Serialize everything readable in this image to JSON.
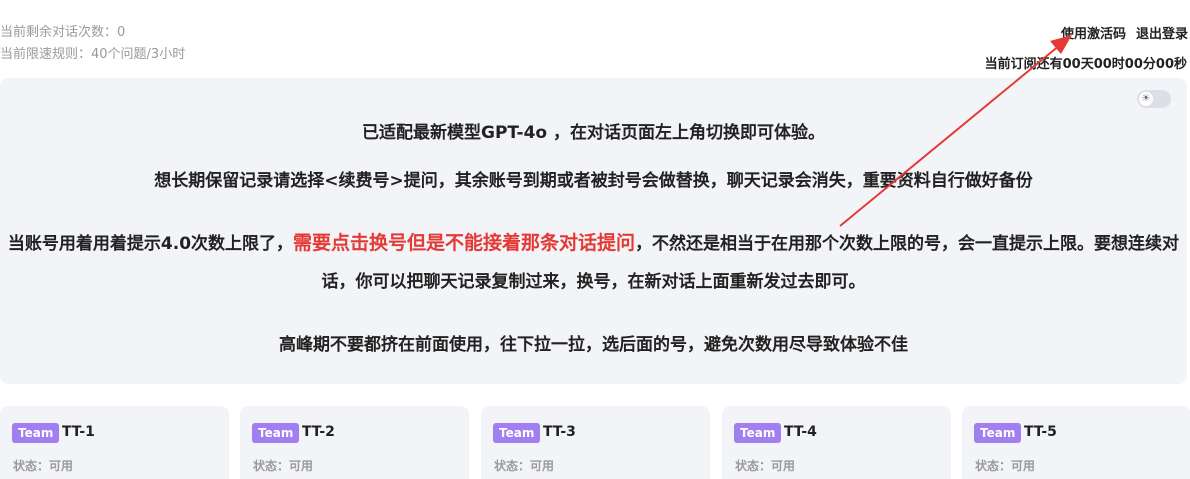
{
  "header": {
    "remaining_label": "当前剩余对话次数：0",
    "rate_limit_label": "当前限速规则：40个问题/3小时",
    "use_code_button": "使用激活码",
    "logout_button": "退出登录",
    "subscription_text": "当前订阅还有00天00时00分00秒"
  },
  "notice": {
    "line1": "已适配最新模型GPT-4o ，在对话页面左上角切换即可体验。",
    "line2": "想长期保留记录请选择<续费号>提问，其余账号到期或者被封号会做替换，聊天记录会消失，重要资料自行做好备份",
    "line3_prefix": "当账号用着用着提示4.0次数上限了，",
    "line3_highlight": "需要点击换号但是不能接着那条对话提问",
    "line3_suffix": "，不然还是相当于在用那个次数上限的号，会一直提示上限。要想连续对话，你可以把聊天记录复制过来，换号，在新对话上面重新发过去即可。",
    "line4": "高峰期不要都挤在前面使用，往下拉一拉，选后面的号，避免次数用尽导致体验不佳",
    "toggle_icon": "sun-icon"
  },
  "cards": [
    {
      "badge": "Team",
      "name": "TT-1",
      "status": "状态：可用"
    },
    {
      "badge": "Team",
      "name": "TT-2",
      "status": "状态：可用"
    },
    {
      "badge": "Team",
      "name": "TT-3",
      "status": "状态：可用"
    },
    {
      "badge": "Team",
      "name": "TT-4",
      "status": "状态：可用"
    },
    {
      "badge": "Team",
      "name": "TT-5",
      "status": "状态：可用"
    }
  ],
  "colors": {
    "highlight": "#e53935",
    "badge": "#a27ff0",
    "annotation_arrow": "#e53935"
  }
}
